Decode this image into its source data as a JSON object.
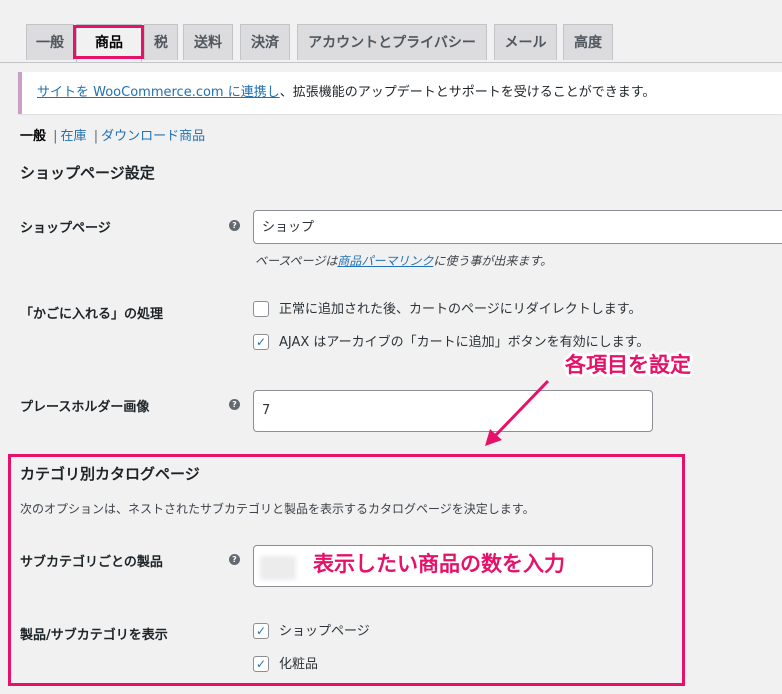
{
  "tabs": [
    {
      "label": "一般"
    },
    {
      "label": "商品"
    },
    {
      "label": "税"
    },
    {
      "label": "送料"
    },
    {
      "label": "決済"
    },
    {
      "label": "アカウントとプライバシー"
    },
    {
      "label": "メール"
    },
    {
      "label": "高度"
    }
  ],
  "active_tab": "商品",
  "notice": {
    "link_text": "サイトを WooCommerce.com に連携し",
    "rest_text": "、拡張機能のアップデートとサポートを受けることができます。"
  },
  "subnav": {
    "current": "一般",
    "items": [
      "在庫",
      "ダウンロード商品"
    ],
    "separator": "|"
  },
  "shop_section": {
    "title": "ショップページ設定",
    "shop_page": {
      "label": "ショップページ",
      "value": "ショップ",
      "desc_prefix": "ベースページは",
      "desc_link": "商品パーマリンク",
      "desc_suffix": "に使う事が出来ます。"
    },
    "cart_behavior": {
      "label": "「かごに入れる」の処理",
      "options": [
        {
          "text": "正常に追加された後、カートのページにリダイレクトします。",
          "checked": false
        },
        {
          "text": "AJAX はアーカイブの「カートに追加」ボタンを有効にします。",
          "checked": true
        }
      ]
    },
    "placeholder_image": {
      "label": "プレースホルダー画像",
      "value": "7"
    }
  },
  "catalog_section": {
    "title": "カテゴリ別カタログページ",
    "description": "次のオプションは、ネストされたサブカテゴリと製品を表示するカタログページを決定します。",
    "products_per_subcategory": {
      "label": "サブカテゴリごとの製品"
    },
    "show_products": {
      "label": "製品/サブカテゴリを表示",
      "options": [
        {
          "text": "ショップページ",
          "checked": true
        },
        {
          "text": "化粧品",
          "checked": true
        }
      ]
    }
  },
  "annotations": {
    "callout_top": "各項目を設定",
    "callout_input": "表示したい商品の数を入力",
    "color": "#e6126a"
  },
  "help_icon": "?"
}
